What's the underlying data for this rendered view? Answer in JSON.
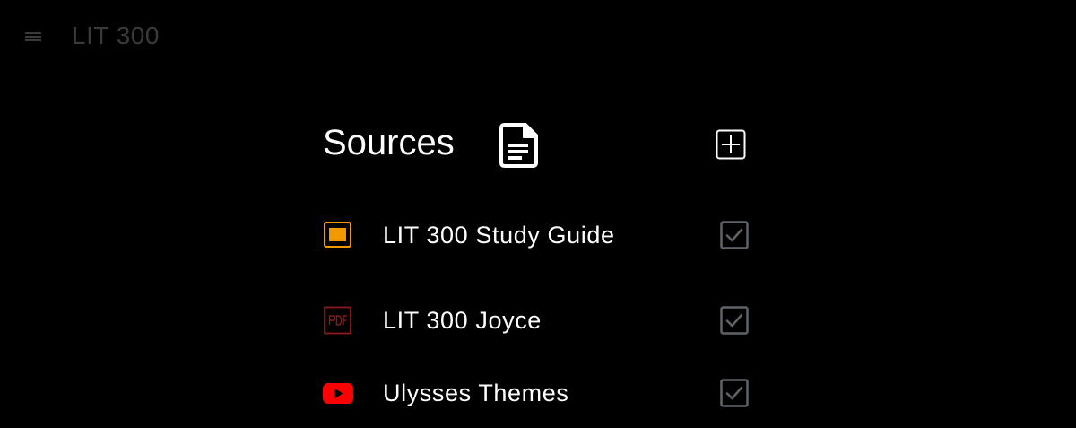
{
  "app": {
    "title": "LIT 300",
    "menu_icon": "hamburger-menu-icon"
  },
  "sources": {
    "heading": "Sources",
    "heading_icon": "document-icon",
    "add_icon": "add-box-icon",
    "items": [
      {
        "label": "LIT 300 Study Guide",
        "type_icon": "slides-icon",
        "icon_color": "#f29900",
        "checked": true
      },
      {
        "label": "LIT 300 Joyce",
        "type_icon": "pdf-icon",
        "icon_color": "#8b1a1a",
        "checked": true
      },
      {
        "label": "Ulysses Themes",
        "type_icon": "youtube-icon",
        "icon_color": "#ff0000",
        "checked": true
      }
    ]
  },
  "colors": {
    "background": "#000000",
    "text": "#ffffff",
    "muted_title": "#3a3a3a",
    "checkbox": "#5f6368"
  }
}
